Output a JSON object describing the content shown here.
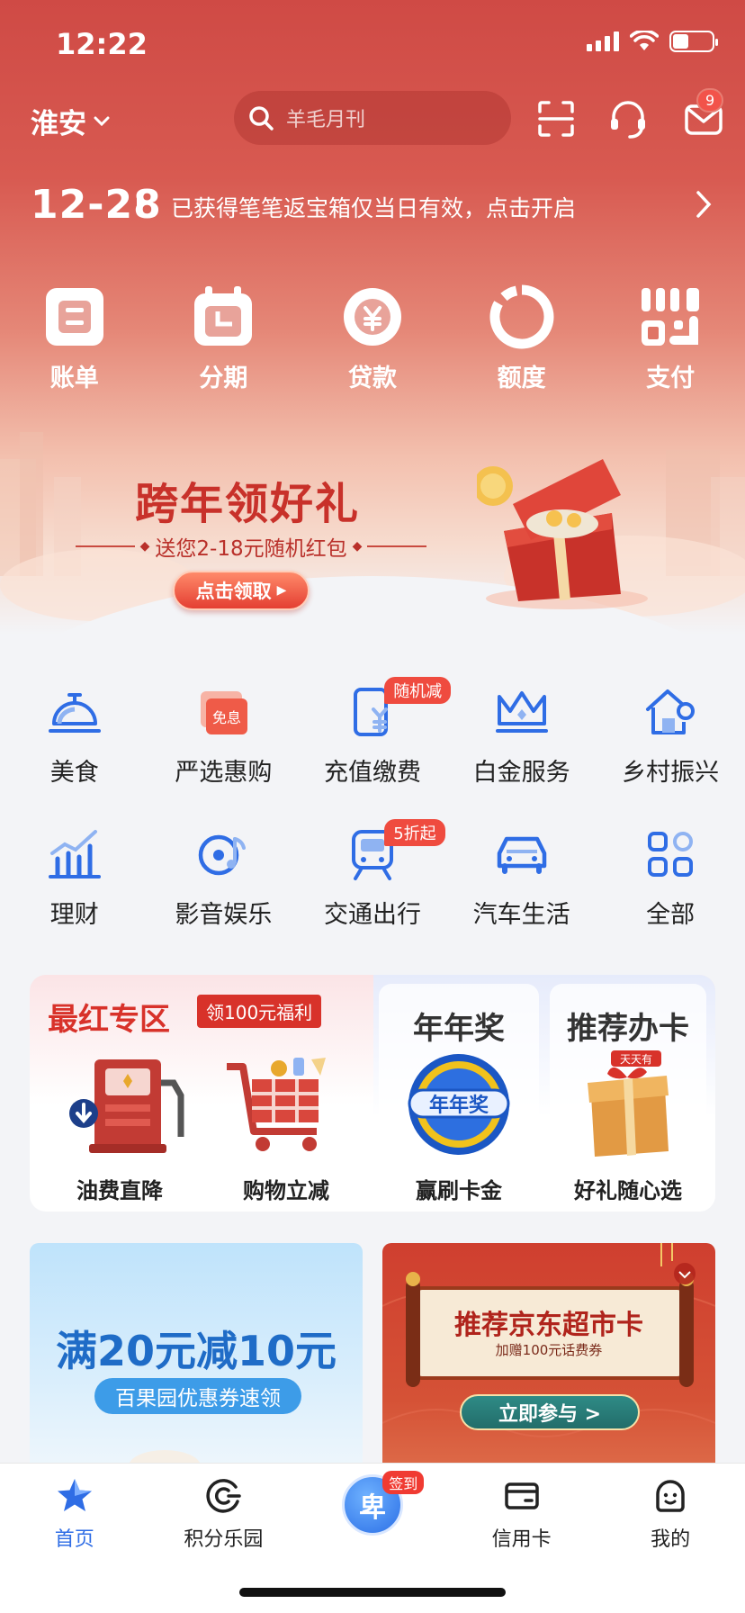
{
  "status": {
    "time": "12:22"
  },
  "header": {
    "city": "淮安",
    "search_placeholder": "羊毛月刊",
    "mail_badge": "9"
  },
  "notice": {
    "date": "12-28",
    "text": "已获得笔笔返宝箱仅当日有效，点击开启"
  },
  "quick_actions": [
    {
      "label": "账单",
      "icon": "bill-icon"
    },
    {
      "label": "分期",
      "icon": "installment-icon"
    },
    {
      "label": "贷款",
      "icon": "loan-icon"
    },
    {
      "label": "额度",
      "icon": "limit-icon"
    },
    {
      "label": "支付",
      "icon": "payment-code-icon"
    }
  ],
  "promo": {
    "title": "跨年领好礼",
    "subtitle": "送您2-18元随机红包",
    "button": "点击领取"
  },
  "services": [
    {
      "label": "美食",
      "icon": "food-bell-icon",
      "tag": ""
    },
    {
      "label": "严选惠购",
      "icon": "coupon-bag-icon",
      "tag": "",
      "icon_text": "免息"
    },
    {
      "label": "充值缴费",
      "icon": "recharge-icon",
      "tag": "随机减"
    },
    {
      "label": "白金服务",
      "icon": "crown-icon",
      "tag": ""
    },
    {
      "label": "乡村振兴",
      "icon": "rural-house-icon",
      "tag": ""
    },
    {
      "label": "理财",
      "icon": "chart-bars-icon",
      "tag": ""
    },
    {
      "label": "影音娱乐",
      "icon": "music-disc-icon",
      "tag": ""
    },
    {
      "label": "交通出行",
      "icon": "train-icon",
      "tag": "5折起"
    },
    {
      "label": "汽车生活",
      "icon": "car-icon",
      "tag": ""
    },
    {
      "label": "全部",
      "icon": "all-grid-icon",
      "tag": ""
    }
  ],
  "featured": {
    "title": "最红专区",
    "tag": "领100元福利",
    "items": [
      {
        "label": "油费直降"
      },
      {
        "label": "购物立减"
      }
    ],
    "panel2": {
      "title": "年年奖",
      "label": "赢刷卡金",
      "pic_text": "年年奖"
    },
    "panel3": {
      "title": "推荐办卡",
      "label": "好礼随心选",
      "pic_text": "天天有"
    }
  },
  "banners": {
    "left": {
      "title": "满20元减10元",
      "subtitle": "百果园优惠券速领"
    },
    "right": {
      "title": "推荐京东超市卡",
      "subtitle": "加赠100元话费券",
      "button": "立即参与 >"
    }
  },
  "tabbar": [
    {
      "label": "首页",
      "icon": "home-star-icon",
      "active": true
    },
    {
      "label": "积分乐园",
      "icon": "points-icon",
      "active": false
    },
    {
      "label": "签到",
      "icon": "checkin-icon",
      "active": false
    },
    {
      "label": "信用卡",
      "icon": "credit-card-icon",
      "active": false
    },
    {
      "label": "我的",
      "icon": "profile-icon",
      "active": false
    }
  ],
  "colors": {
    "brand_red": "#d8322a",
    "brand_blue": "#2f6de5"
  }
}
